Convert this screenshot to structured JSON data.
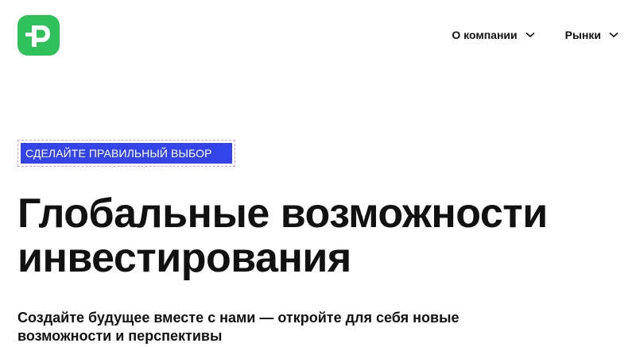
{
  "brand": {
    "logo_icon": "p-logo-icon",
    "color": "#2fc25b"
  },
  "nav": {
    "items": [
      {
        "label": "О компании",
        "icon": "chevron-down-icon"
      },
      {
        "label": "Рынки",
        "icon": "chevron-down-icon"
      }
    ]
  },
  "hero": {
    "tag": "СДЕЛАЙТЕ ПРАВИЛЬНЫЙ ВЫБОР",
    "tag_color": "#3344e8",
    "title_line1": "Глобальные возможности",
    "title_line2": "инвестирования",
    "subtitle_line1": "Создайте будущее вместе с нами — откройте для себя новые",
    "subtitle_line2": "возможности и перспективы"
  }
}
